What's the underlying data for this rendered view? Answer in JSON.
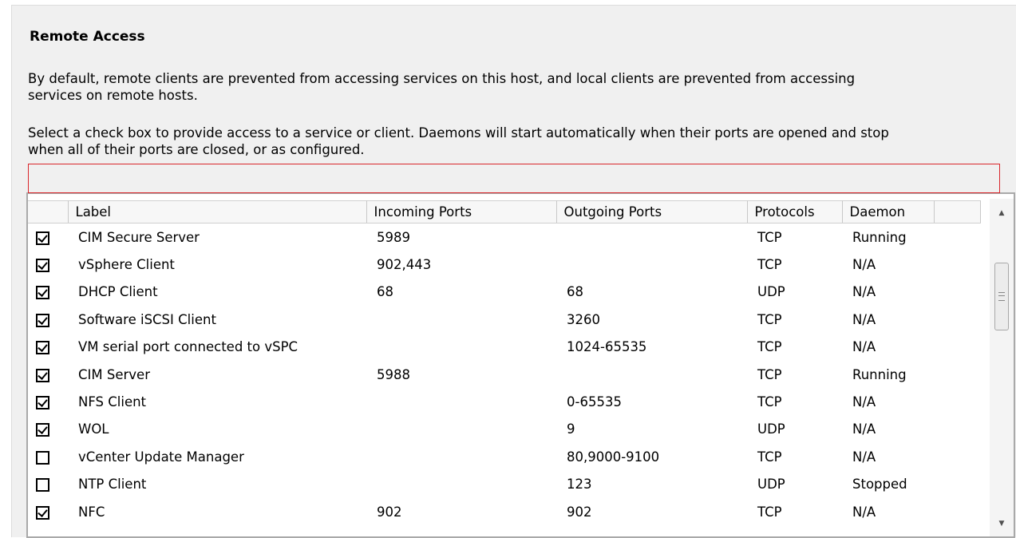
{
  "section": {
    "title": "Remote Access",
    "description1": "By default, remote clients are prevented from accessing services on this host, and local clients are prevented from accessing services on remote hosts.",
    "description2": "Select a check box to provide access to a service or client. Daemons will start automatically when their ports are opened and stop when all of their ports are closed, or as configured."
  },
  "grid": {
    "columns": [
      "Label",
      "Incoming Ports",
      "Outgoing Ports",
      "Protocols",
      "Daemon"
    ],
    "rows": [
      {
        "checked": true,
        "label": "CIM Secure Server",
        "incoming": "5989",
        "outgoing": "",
        "protocol": "TCP",
        "daemon": "Running"
      },
      {
        "checked": true,
        "label": "vSphere Client",
        "incoming": "902,443",
        "outgoing": "",
        "protocol": "TCP",
        "daemon": "N/A"
      },
      {
        "checked": true,
        "label": "DHCP Client",
        "incoming": "68",
        "outgoing": "68",
        "protocol": "UDP",
        "daemon": "N/A"
      },
      {
        "checked": true,
        "label": "Software iSCSI Client",
        "incoming": "",
        "outgoing": "3260",
        "protocol": "TCP",
        "daemon": "N/A"
      },
      {
        "checked": true,
        "label": "VM serial port connected to vSPC",
        "incoming": "",
        "outgoing": "1024-65535",
        "protocol": "TCP",
        "daemon": "N/A"
      },
      {
        "checked": true,
        "label": "CIM Server",
        "incoming": "5988",
        "outgoing": "",
        "protocol": "TCP",
        "daemon": "Running"
      },
      {
        "checked": true,
        "label": "NFS Client",
        "incoming": "",
        "outgoing": "0-65535",
        "protocol": "TCP",
        "daemon": "N/A"
      },
      {
        "checked": true,
        "label": "WOL",
        "incoming": "",
        "outgoing": "9",
        "protocol": "UDP",
        "daemon": "N/A"
      },
      {
        "checked": false,
        "label": "vCenter Update Manager",
        "incoming": "",
        "outgoing": "80,9000-9100",
        "protocol": "TCP",
        "daemon": "N/A"
      },
      {
        "checked": false,
        "label": "NTP Client",
        "incoming": "",
        "outgoing": "123",
        "protocol": "UDP",
        "daemon": "Stopped"
      },
      {
        "checked": true,
        "label": "NFC",
        "incoming": "902",
        "outgoing": "902",
        "protocol": "TCP",
        "daemon": "N/A"
      }
    ]
  },
  "scrollbar": {
    "up_icon": "scroll-up-arrow-icon",
    "down_icon": "scroll-down-arrow-icon"
  },
  "colors": {
    "highlight_border": "#d9262b",
    "panel_background": "#f0f0f0"
  }
}
